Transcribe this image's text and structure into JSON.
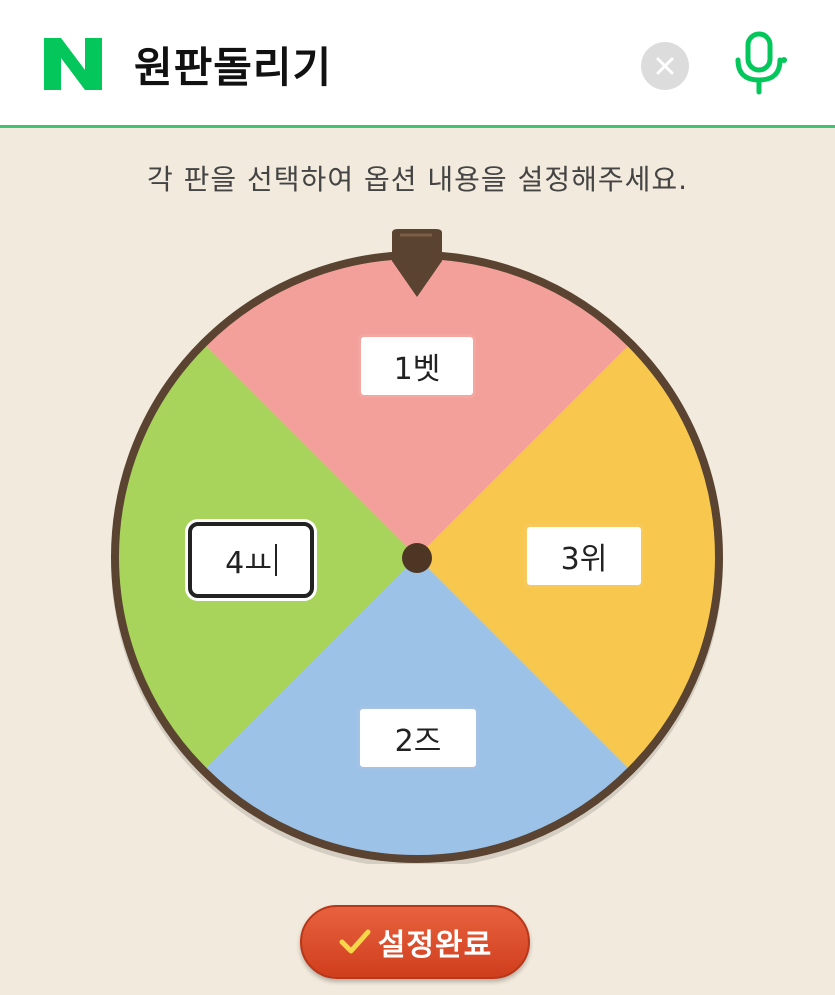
{
  "header": {
    "logo_letter": "N",
    "query": "원판돌리기"
  },
  "instruction": "각 판을 선택하여 옵션 내용을 설정해주세요.",
  "wheel": {
    "segments": [
      {
        "label": "1벳",
        "color": "#f4a09a"
      },
      {
        "label": "3위",
        "color": "#f8c84e"
      },
      {
        "label": "2즈",
        "color": "#9dc2e8"
      },
      {
        "label": "4ㅛ",
        "color": "#a9d45c"
      }
    ],
    "rim_color": "#5a4330",
    "editing_segment": "4ㅛ"
  },
  "done_button": {
    "label": "설정완료",
    "color": "#d9452a"
  },
  "colors": {
    "accent_green": "#03c75a",
    "header_border": "#3fc274",
    "background": "#f2eadc"
  }
}
